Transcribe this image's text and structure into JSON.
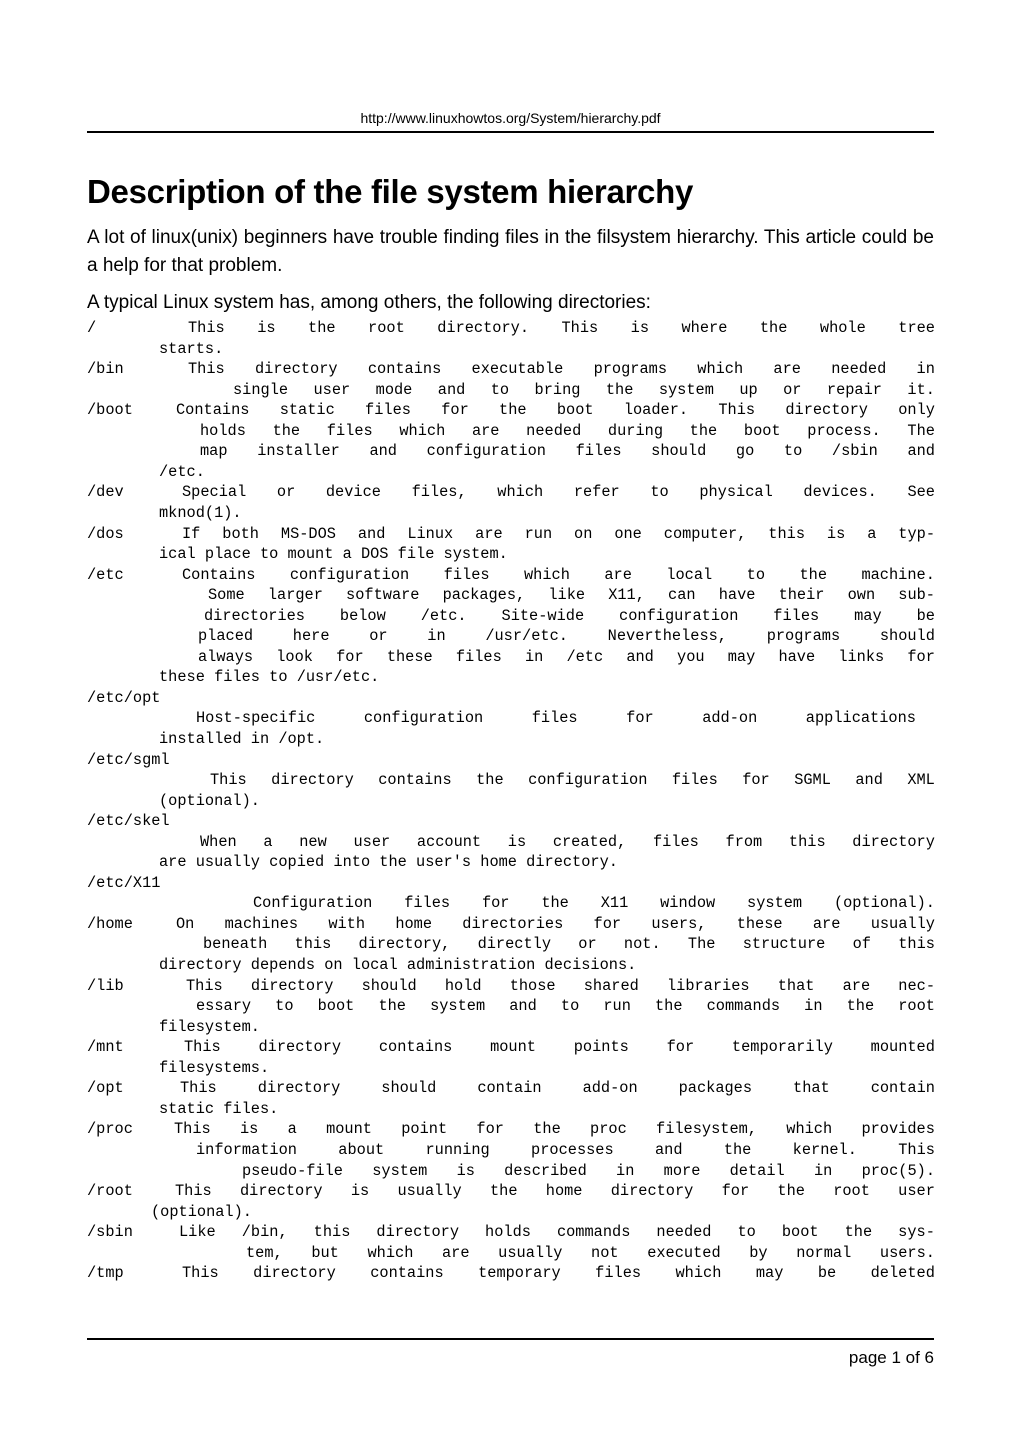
{
  "header": {
    "url": "http://www.linuxhowtos.org/System/hierarchy.pdf"
  },
  "title": "Description of the file system hierarchy",
  "intro": "A lot of linux(unix) beginners have trouble finding files in the filsystem hierarchy. This article could be a help for that problem.",
  "lead": "A typical Linux system has, among others, the following directories:",
  "entries": [
    {
      "path": "/",
      "lines": [
        "This is the root directory. This is where the whole tree",
        "starts."
      ]
    },
    {
      "path": "/bin",
      "lines": [
        "This directory contains executable programs which are needed in",
        "single user mode and to bring the system up or repair it."
      ]
    },
    {
      "path": "/boot",
      "lines": [
        "Contains static files for the boot loader. This directory only",
        "holds the files which are needed during the boot process. The",
        "map installer and configuration files should go to /sbin and",
        "/etc."
      ]
    },
    {
      "path": "/dev",
      "lines": [
        "Special or device files, which refer to physical devices. See",
        "mknod(1)."
      ]
    },
    {
      "path": "/dos",
      "lines": [
        "If both MS-DOS and Linux are run on one computer, this is a typ-",
        "ical place to mount a DOS file system."
      ]
    },
    {
      "path": "/etc",
      "lines": [
        "Contains configuration files which are local to the machine.",
        "Some larger software packages, like X11, can have their own sub-",
        "directories below /etc. Site-wide configuration files may be",
        "placed here or in /usr/etc. Nevertheless, programs should",
        "always look for these files in /etc and you may have links for",
        "these files to /usr/etc."
      ]
    },
    {
      "path": "/etc/opt",
      "lines": [
        "Host-specific configuration files for add-on applications",
        "installed in /opt."
      ]
    },
    {
      "path": "/etc/sgml",
      "lines": [
        "This directory contains the configuration files for SGML and XML",
        "(optional)."
      ]
    },
    {
      "path": "/etc/skel",
      "lines": [
        "When a new user account is created, files from this directory",
        "are usually copied into the user's home directory."
      ]
    },
    {
      "path": "/etc/X11",
      "lines": [
        "Configuration files for the X11 window system (optional)."
      ]
    },
    {
      "path": "/home",
      "lines": [
        "On machines with home directories for users, these are usually",
        "beneath this directory, directly or not. The structure of this",
        "directory depends on local administration decisions."
      ]
    },
    {
      "path": "/lib",
      "lines": [
        "This directory should hold those shared libraries that are nec-",
        "essary to boot the system and to run the commands in the root",
        "filesystem."
      ]
    },
    {
      "path": "/mnt",
      "lines": [
        "This directory contains mount points for temporarily mounted",
        "filesystems."
      ]
    },
    {
      "path": "/opt",
      "lines": [
        "This directory should contain add-on packages that contain",
        "static files."
      ]
    },
    {
      "path": "/proc",
      "lines": [
        "This is a mount point for the proc filesystem, which provides",
        "information about running processes and the kernel. This",
        "pseudo-file system is described in more detail in proc(5)."
      ]
    },
    {
      "path": "/root",
      "lines": [
        "This directory is usually the home directory for the root user",
        "(optional)."
      ]
    },
    {
      "path": "/sbin",
      "lines": [
        "Like /bin, this directory holds commands needed to boot the sys-",
        "tem, but which are usually not executed by normal users."
      ]
    },
    {
      "path": "/tmp",
      "lines": [
        "This directory contains temporary files which may be deleted"
      ]
    }
  ],
  "footer": {
    "page_label": "page 1 of 6",
    "page_current": 1,
    "page_total": 6
  }
}
